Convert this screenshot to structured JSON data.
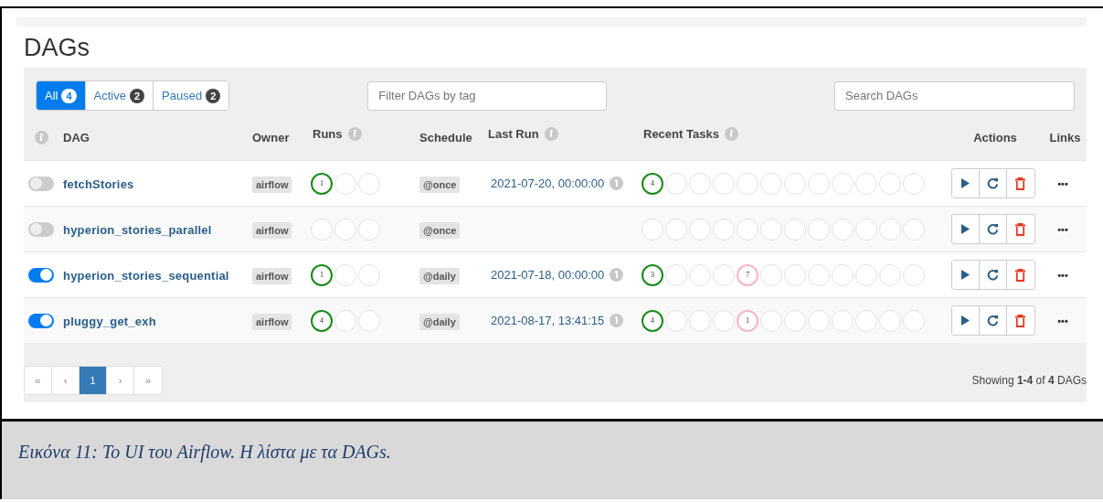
{
  "title": "DAGs",
  "filter_tabs": [
    {
      "label": "All",
      "count": "4",
      "selected": true
    },
    {
      "label": "Active",
      "count": "2",
      "selected": false
    },
    {
      "label": "Paused",
      "count": "2",
      "selected": false
    }
  ],
  "tag_filter": {
    "placeholder": "Filter DAGs by tag"
  },
  "search": {
    "placeholder": "Search DAGs"
  },
  "columns": [
    "DAG",
    "Owner",
    "Runs",
    "Schedule",
    "Last Run",
    "Recent Tasks",
    "Actions",
    "Links"
  ],
  "rows": [
    {
      "on": false,
      "dag": "fetchStories",
      "owner": "airflow",
      "runs": [
        {
          "kind": "success",
          "count": "1"
        },
        {
          "kind": "none"
        },
        {
          "kind": "none"
        }
      ],
      "schedule": "@once",
      "last_run": "2021-07-20, 00:00:00",
      "tasks": [
        {
          "kind": "success",
          "count": "4"
        },
        {
          "kind": "none"
        },
        {
          "kind": "none"
        },
        {
          "kind": "none"
        },
        {
          "kind": "none"
        },
        {
          "kind": "none"
        },
        {
          "kind": "none"
        },
        {
          "kind": "none"
        },
        {
          "kind": "none"
        },
        {
          "kind": "none"
        },
        {
          "kind": "none"
        },
        {
          "kind": "none"
        }
      ],
      "links": "•••"
    },
    {
      "on": false,
      "dag": "hyperion_stories_parallel",
      "owner": "airflow",
      "runs": [
        {
          "kind": "none"
        },
        {
          "kind": "none"
        },
        {
          "kind": "none"
        }
      ],
      "schedule": "@once",
      "tasks": [
        {
          "kind": "none"
        },
        {
          "kind": "none"
        },
        {
          "kind": "none"
        },
        {
          "kind": "none"
        },
        {
          "kind": "none"
        },
        {
          "kind": "none"
        },
        {
          "kind": "none"
        },
        {
          "kind": "none"
        },
        {
          "kind": "none"
        },
        {
          "kind": "none"
        },
        {
          "kind": "none"
        },
        {
          "kind": "none"
        }
      ],
      "links": "•••"
    },
    {
      "on": true,
      "dag": "hyperion_stories_sequential",
      "owner": "airflow",
      "runs": [
        {
          "kind": "success",
          "count": "1"
        },
        {
          "kind": "none"
        },
        {
          "kind": "none"
        }
      ],
      "schedule": "@daily",
      "last_run": "2021-07-18, 00:00:00",
      "tasks": [
        {
          "kind": "success",
          "count": "3"
        },
        {
          "kind": "none"
        },
        {
          "kind": "none"
        },
        {
          "kind": "none"
        },
        {
          "kind": "skipped",
          "count": "7"
        },
        {
          "kind": "none"
        },
        {
          "kind": "none"
        },
        {
          "kind": "none"
        },
        {
          "kind": "none"
        },
        {
          "kind": "none"
        },
        {
          "kind": "none"
        },
        {
          "kind": "none"
        }
      ],
      "links": "•••"
    },
    {
      "on": true,
      "dag": "pluggy_get_exh",
      "owner": "airflow",
      "runs": [
        {
          "kind": "success",
          "count": "4"
        },
        {
          "kind": "none"
        },
        {
          "kind": "none"
        }
      ],
      "schedule": "@daily",
      "last_run": "2021-08-17, 13:41:15",
      "tasks": [
        {
          "kind": "success",
          "count": "4"
        },
        {
          "kind": "none"
        },
        {
          "kind": "none"
        },
        {
          "kind": "none"
        },
        {
          "kind": "skipped",
          "count": "1"
        },
        {
          "kind": "none"
        },
        {
          "kind": "none"
        },
        {
          "kind": "none"
        },
        {
          "kind": "none"
        },
        {
          "kind": "none"
        },
        {
          "kind": "none"
        },
        {
          "kind": "none"
        }
      ],
      "links": "•••"
    }
  ],
  "pagination": [
    {
      "label": "«",
      "selected": false
    },
    {
      "label": "‹",
      "selected": false
    },
    {
      "label": "1",
      "selected": true
    },
    {
      "label": "›",
      "selected": false
    },
    {
      "label": "»",
      "selected": false
    }
  ],
  "showing": "Showing **1-4** of **4** DAGs",
  "caption": "Εικόνα 11: Το UI του Airflow. Η λίστα με τα DAGs."
}
